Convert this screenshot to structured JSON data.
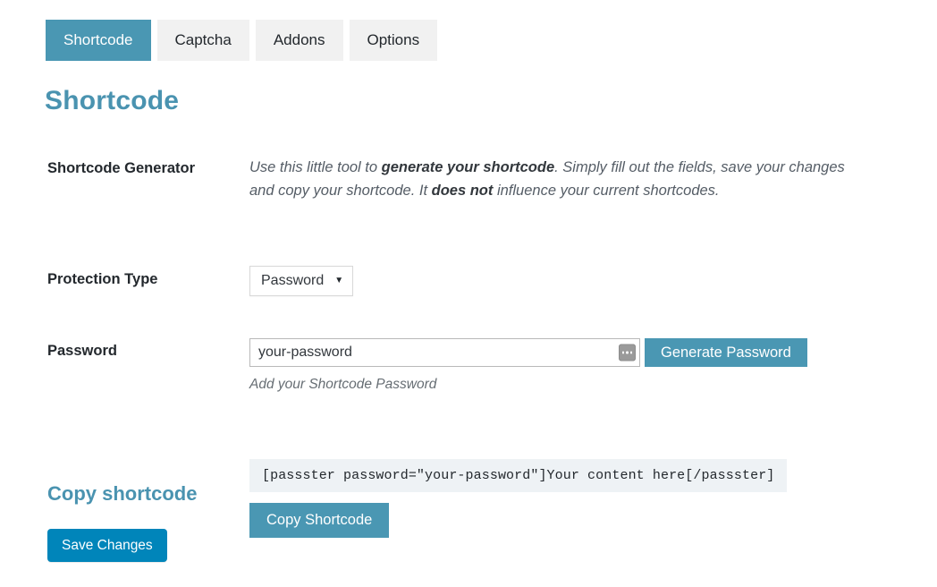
{
  "tabs": [
    {
      "label": "Shortcode",
      "active": true
    },
    {
      "label": "Captcha",
      "active": false
    },
    {
      "label": "Addons",
      "active": false
    },
    {
      "label": "Options",
      "active": false
    }
  ],
  "page": {
    "title": "Shortcode"
  },
  "rows": {
    "generator": {
      "label": "Shortcode Generator",
      "description_part1": "Use this little tool to ",
      "description_bold1": "generate your shortcode",
      "description_part2": ". Simply fill out the fields, save your changes and copy your shortcode. It ",
      "description_bold2": "does not",
      "description_part3": " influence your current shortcodes."
    },
    "protection": {
      "label": "Protection Type",
      "select_value": "Password",
      "select_caret": "▼",
      "options": [
        "Password"
      ]
    },
    "password": {
      "label": "Password",
      "input_value": "your-password",
      "input_placeholder": "your-password",
      "reveal_icon": "password-dots-icon",
      "generate_button": "Generate Password",
      "help_text": "Add your Shortcode Password"
    },
    "copy": {
      "label": "Copy shortcode",
      "shortcode": "[passster password=\"your-password\"]Your content here[/passster]",
      "copy_button": "Copy Shortcode"
    }
  },
  "footer": {
    "save_button": "Save Changes"
  },
  "colors": {
    "accent_teal": "#4a97b3",
    "heading_blue": "#4a93b0",
    "save_blue": "#0085ba",
    "tab_inactive_bg": "#f1f1f1",
    "code_bg": "#eef2f5"
  }
}
